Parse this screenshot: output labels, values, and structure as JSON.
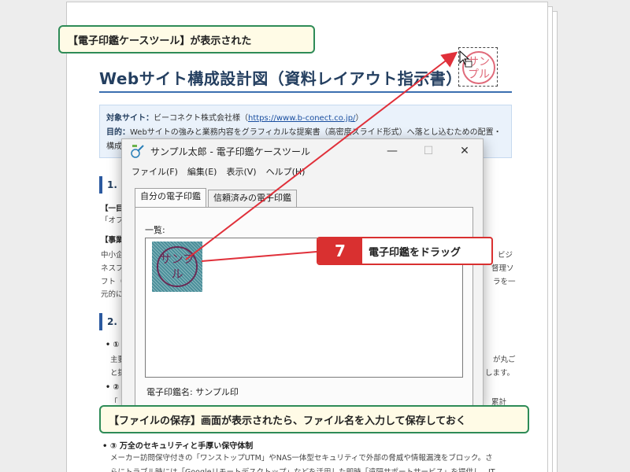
{
  "document": {
    "title": "Webサイト構成設計図（資料レイアウト指示書）",
    "info": {
      "target_label": "対象サイト：",
      "target_value": "ビーコネクト株式会社様（",
      "target_url": "https://www.b-conect.co.jp/",
      "target_close": "）",
      "purpose_label": "目的：",
      "purpose_value": "Webサイトの強みと業務内容をグラフィカルな提案書（高密度スライド形式）へ落とし込むための配置・",
      "purpose_cont": "構成"
    },
    "section1_head": "1. ",
    "section2_head": "2. ",
    "fragments_left": [
      "【一目",
      "「オフ",
      "【事業",
      "中小企",
      "ネスフ",
      "フト（",
      "元的に"
    ],
    "fragments_right": [
      "ビジ",
      "督理ソ",
      "ラを一"
    ],
    "sec2_left": [
      "• ①",
      "主要",
      "と提",
      "• ②",
      "「"
    ],
    "sec2_right": [
      "が丸ご",
      "します。",
      "累計"
    ],
    "bottom_heading": "• ③ 万全のセキュリティと手厚い保守体制",
    "bottom_line1": "メーカー訪問保守付きの「ワンストップUTM」やNAS一体型セキュリティで外部の脅威や情報漏洩をブロック。さ",
    "bottom_line2": "らにトラブル時には「Googleリモートデスクトップ」などを活用した即時「遠隔サポートサービス」を提供し、IT",
    "stamp_text": "サンプル"
  },
  "callouts": {
    "top": "【電子印鑑ケースツール】が表示された",
    "bottom": "【ファイルの保存】画面が表示されたら、ファイル名を入力して保存しておく",
    "step_number": "7",
    "step_text": "電子印鑑をドラッグ"
  },
  "window": {
    "title": "サンプル太郎 - 電子印鑑ケースツール",
    "minimize": "—",
    "maximize": "☐",
    "close": "✕",
    "menu": [
      "ファイル(F)",
      "編集(E)",
      "表示(V)",
      "ヘルプ(H)"
    ],
    "tabs": [
      "自分の電子印鑑",
      "信頼済みの電子印鑑"
    ],
    "list_label": "一覧:",
    "stamp_item_text": "サンプル",
    "stamp_name": "電子印鑑名: サンプル印"
  },
  "colors": {
    "callout_border": "#2e8b57",
    "step_red": "#d93030",
    "title_blue": "#243f60",
    "stamp_pink": "#e06a7a",
    "stamp_teal": "#4a8f9a"
  }
}
